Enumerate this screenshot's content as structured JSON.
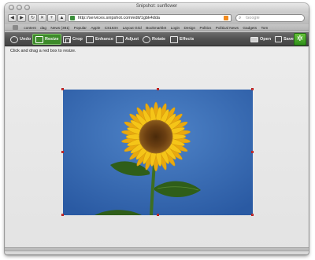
{
  "window": {
    "title": "Snipshot: sunflower"
  },
  "navigation": {
    "url": "http://services.snipshot.com/edit/1gbk4dda",
    "search_placeholder": "Google"
  },
  "bookmarks": [
    "content",
    "dag",
    "News (381)",
    "Popular",
    "Apple",
    "CS163A",
    "Layout Grid",
    "Bookmarklet",
    "Login",
    "Design",
    "Politics",
    "Political News",
    "Gadgets",
    "Tom"
  ],
  "app_toolbar": {
    "undo": "Undo",
    "resize": "Resize",
    "crop": "Crop",
    "enhance": "Enhance",
    "adjust": "Adjust",
    "rotate": "Rotate",
    "effects": "Effects",
    "open": "Open",
    "save": "Save"
  },
  "hint": "Click and drag a red box to resize.",
  "colors": {
    "sky": "#3c6eb6",
    "petal": "#f5c518",
    "center": "#6b3f12",
    "leaf": "#3d6e22",
    "active_tool": "#3d8b2a",
    "handle": "#e04848"
  }
}
